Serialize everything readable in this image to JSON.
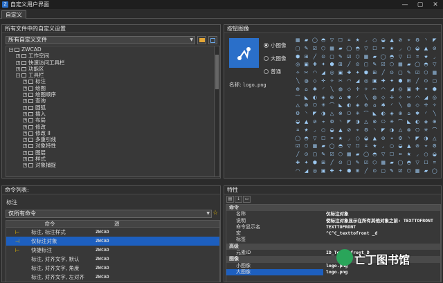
{
  "window": {
    "title": "自定义用户界面",
    "controls": [
      "—",
      "▢",
      "✕"
    ]
  },
  "tabs": [
    {
      "label": "自定义"
    }
  ],
  "left_top": {
    "header": "所有文件中的自定义设置",
    "combo_value": "所有自定义文件",
    "tree": [
      {
        "label": "ZWCAD",
        "level": 0,
        "toggle": "−"
      },
      {
        "label": "工作空间",
        "level": 1,
        "toggle": "+"
      },
      {
        "label": "快速访问工具栏",
        "level": 1,
        "toggle": "+"
      },
      {
        "label": "功能区",
        "level": 1,
        "toggle": "+"
      },
      {
        "label": "工具栏",
        "level": 1,
        "toggle": "−"
      },
      {
        "label": "标注",
        "level": 2,
        "toggle": "+"
      },
      {
        "label": "绘图",
        "level": 2,
        "toggle": "+"
      },
      {
        "label": "绘图顺序",
        "level": 2,
        "toggle": "+"
      },
      {
        "label": "查询",
        "level": 2,
        "toggle": "+"
      },
      {
        "label": "圆弧",
        "level": 2,
        "toggle": "+"
      },
      {
        "label": "插入",
        "level": 2,
        "toggle": "+"
      },
      {
        "label": "布局",
        "level": 2,
        "toggle": "+"
      },
      {
        "label": "修改",
        "level": 2,
        "toggle": "+"
      },
      {
        "label": "修改 II",
        "level": 2,
        "toggle": "+"
      },
      {
        "label": "多重引线",
        "level": 2,
        "toggle": "+"
      },
      {
        "label": "对象特性",
        "level": 2,
        "toggle": "+"
      },
      {
        "label": "图层",
        "level": 2,
        "toggle": "+"
      },
      {
        "label": "样式",
        "level": 2,
        "toggle": "+"
      },
      {
        "label": "对象捕捉",
        "level": 2,
        "toggle": "+"
      }
    ]
  },
  "button_image": {
    "header": "按钮图像",
    "name_label": "名称:",
    "name_value": "logo.png",
    "radios": [
      {
        "label": "小图像",
        "selected": true
      },
      {
        "label": "大图像",
        "selected": false
      },
      {
        "label": "普通",
        "selected": false
      }
    ]
  },
  "command_list": {
    "header": "命令列表:",
    "search_label": "标注",
    "filter_value": "仅所有命令",
    "columns": [
      "命令",
      "源"
    ],
    "rows": [
      {
        "icon": "⊢",
        "name": "标注, 标注样式",
        "source": "ZWCAD",
        "selected": false
      },
      {
        "icon": "⊣",
        "name": "仅标注对象",
        "source": "ZWCAD",
        "selected": true
      },
      {
        "icon": "⊢",
        "name": "快捷标注",
        "source": "ZWCAD",
        "selected": false
      },
      {
        "icon": "",
        "name": "标注, 对齐文字, 默认",
        "source": "ZWCAD",
        "selected": false
      },
      {
        "icon": "",
        "name": "标注, 对齐文字, 角度",
        "source": "ZWCAD",
        "selected": false
      },
      {
        "icon": "",
        "name": "标注, 对齐文字, 左对齐",
        "source": "ZWCAD",
        "selected": false
      }
    ]
  },
  "properties": {
    "header": "特性",
    "rows": [
      {
        "type": "cat",
        "key": "命令",
        "value": ""
      },
      {
        "type": "prop",
        "key": "名称",
        "value": "仅标注对象"
      },
      {
        "type": "prop",
        "key": "说明",
        "value": "使标注对象显示在所有其他对象之前: TEXTTOFRONT"
      },
      {
        "type": "prop",
        "key": "命令显示名",
        "value": "TEXTTOFRONT"
      },
      {
        "type": "prop",
        "key": "宏",
        "value": "^C^C_texttofront _d"
      },
      {
        "type": "prop",
        "key": "标签",
        "value": ""
      },
      {
        "type": "cat",
        "key": "高级",
        "value": ""
      },
      {
        "type": "prop",
        "key": "元素ID",
        "value": "ID_Texttofront_D"
      },
      {
        "type": "cat",
        "key": "图像",
        "value": ""
      },
      {
        "type": "prop",
        "key": "小图像",
        "value": "logo.png"
      },
      {
        "type": "prop",
        "key": "大图像",
        "value": "logo.png",
        "selected": true
      }
    ]
  },
  "watermark": {
    "text": "亡丁图书馆"
  },
  "colors": {
    "accent": "#1d5fbf",
    "icon": "#9cc8f0",
    "panel": "#333333"
  }
}
